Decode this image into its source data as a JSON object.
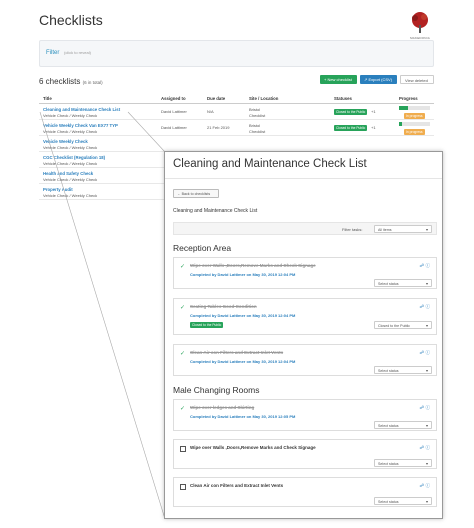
{
  "page": {
    "title": "Checklists",
    "logo_text": "MAKEDONIA"
  },
  "filter": {
    "label": "Filter",
    "hint": "(click to reveal)"
  },
  "summary": {
    "count": "6 checklists",
    "total": "(6 in total)"
  },
  "buttons": {
    "new": "+ New checklist",
    "export": "↗ Export (CSV)",
    "view_deleted": "View deleted"
  },
  "table": {
    "headers": [
      "Title",
      "Assigned to",
      "Due date",
      "Site / Location",
      "Statuses",
      "Progress"
    ],
    "rows": [
      {
        "title": "Cleaning and Maintenance Check List",
        "sub": "Vehicle Check / Weekly Check",
        "assigned": "David Lattimer",
        "due": "N/A",
        "site": "Bristol",
        "site2": "Checklist",
        "status": "Closed to the Public",
        "status_count": "+1",
        "progress": 0.3,
        "tag": "In progress"
      },
      {
        "title": "Vehicle Weekly Check Van EX77 TYP",
        "sub": "Vehicle Check / Weekly Check",
        "assigned": "David Lattimer",
        "due": "21 Feb 2019",
        "site": "Bristol",
        "site2": "Checklist",
        "status": "Closed to the Public",
        "status_count": "+1",
        "progress": 0.1,
        "tag": "In progress"
      },
      {
        "title": "Vehicle Weekly Check",
        "sub": "Vehicle Check / Weekly Check"
      },
      {
        "title": "CGC Checklist (Regulation 18)",
        "sub": "Vehicle Check / Weekly Check"
      },
      {
        "title": "Health and Safety Check",
        "sub": "Vehicle Check / Weekly Check"
      },
      {
        "title": "Property Audit",
        "sub": "Vehicle Check / Weekly Check"
      }
    ]
  },
  "detail": {
    "title": "Cleaning and Maintenance Check List",
    "back": "← Back to checklists",
    "name": "Cleaning and Maintenance Check List",
    "filter_label": "Filter tasks:",
    "filter_value": "All items",
    "sections": [
      {
        "heading": "Reception Area",
        "items": [
          {
            "text": "Wipe over Walls ,Doors,Remove Marks and Check Signage",
            "done": true,
            "completed": "Completed by David Lattimer on May 30, 2019 12:04 PM",
            "select": "Select status"
          },
          {
            "text": "Seating Tables Good Condition",
            "done": true,
            "completed": "Completed by David Lattimer on May 30, 2019 12:04 PM",
            "status": "Closed to the Public",
            "select": "Closed to the Public"
          },
          {
            "text": "Clean Air con Filters and Extract Inlet Vents",
            "done": true,
            "completed": "Completed by David Lattimer on May 30, 2019 12:04 PM",
            "select": "Select status"
          }
        ]
      },
      {
        "heading": "Male Changing Rooms",
        "items": [
          {
            "text": "Wipe over ledges and Skirting",
            "done": true,
            "completed": "Completed by David Lattimer on May 30, 2019 12:05 PM",
            "select": "Select status"
          },
          {
            "text": "Wipe over Walls ,Doors,Remove Marks and Check Signage",
            "done": false,
            "select": "Select status"
          },
          {
            "text": "Clean Air con Filters and Extract Inlet Vents",
            "done": false,
            "select": "Select status"
          }
        ]
      }
    ]
  },
  "icons": {
    "check": "check-icon",
    "link": "link-icon",
    "info": "info-icon",
    "caret": "chevron-down-icon"
  },
  "colors": {
    "green": "#27a35a",
    "blue": "#2a7fbd",
    "orange": "#f0ad4e"
  }
}
